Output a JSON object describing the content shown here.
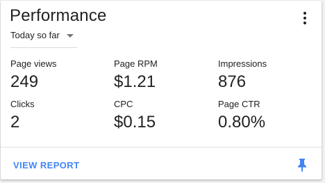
{
  "card": {
    "title": "Performance",
    "menu_icon": "more-vert-icon",
    "range_selector": {
      "selected": "Today so far",
      "icon": "dropdown-caret-icon"
    },
    "metrics": [
      {
        "label": "Page views",
        "value": "249"
      },
      {
        "label": "Page RPM",
        "value": "$1.21"
      },
      {
        "label": "Impressions",
        "value": "876"
      },
      {
        "label": "Clicks",
        "value": "2"
      },
      {
        "label": "CPC",
        "value": "$0.15"
      },
      {
        "label": "Page CTR",
        "value": "0.80%"
      }
    ],
    "footer": {
      "view_report_label": "VIEW REPORT",
      "pin_icon": "pin-icon"
    }
  },
  "colors": {
    "accent": "#4285f4",
    "text": "#212121",
    "background": "#f1f1f1",
    "card": "#ffffff"
  }
}
